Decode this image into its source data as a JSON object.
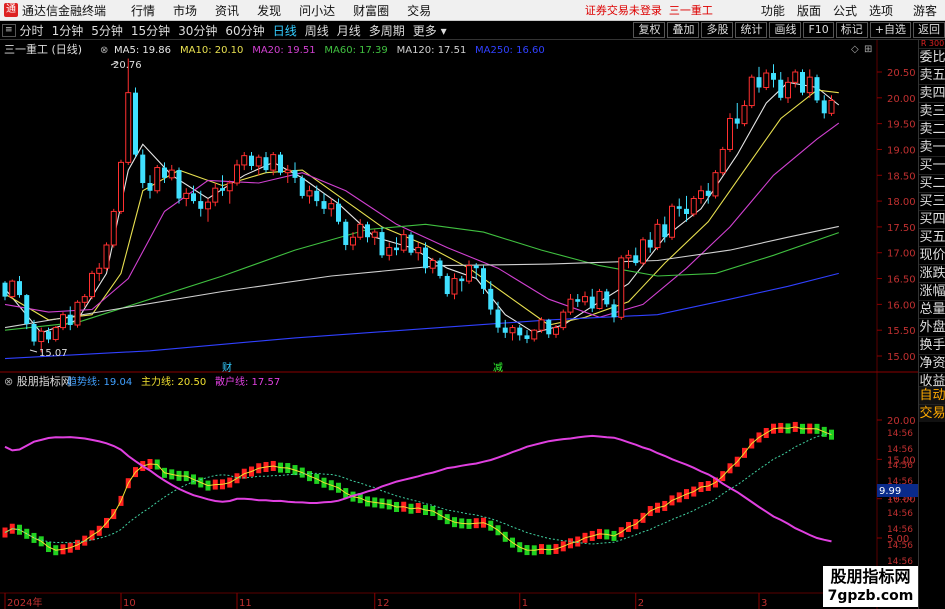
{
  "app": {
    "logo": "通",
    "title": "通达信金融终端",
    "menus": [
      "行情",
      "市场",
      "资讯",
      "发现",
      "问小达",
      "财富圈",
      "交易"
    ],
    "notice": "证券交易未登录",
    "stock_name": "三一重工",
    "right_menus": [
      "功能",
      "版面",
      "公式",
      "选项"
    ],
    "guest": "游客"
  },
  "toolbar": {
    "pt": "≡",
    "periods": [
      "分时",
      "1分钟",
      "5分钟",
      "15分钟",
      "30分钟",
      "60分钟",
      "日线",
      "周线",
      "月线",
      "多周期",
      "更多"
    ],
    "active_period": "日线",
    "right_buttons": [
      "复权",
      "叠加",
      "多股",
      "统计",
      "画线",
      "F10",
      "标记",
      "+自选",
      "返回"
    ]
  },
  "side": {
    "tag": "R 300",
    "items": [
      "委比",
      "卖五",
      "卖四",
      "卖三",
      "卖二",
      "卖一",
      "买一",
      "买二",
      "买三",
      "买四",
      "买五",
      "现价",
      "涨跌",
      "涨幅",
      "总量",
      "外盘",
      "换手",
      "净资",
      "收益",
      "自动",
      "交易"
    ]
  },
  "main": {
    "title": "三一重工 (日线)",
    "legend": [
      {
        "text": "MA5: 19.86",
        "color": "#e6e6e6"
      },
      {
        "text": "MA10: 20.10",
        "color": "#e8e050"
      },
      {
        "text": "MA20: 19.51",
        "color": "#d040d0"
      },
      {
        "text": "MA60: 17.39",
        "color": "#40c040"
      },
      {
        "text": "MA120: 17.51",
        "color": "#d0d0d0"
      },
      {
        "text": "MA250: 16.60",
        "color": "#3040ff"
      }
    ],
    "y_ticks": [
      "20.50",
      "20.00",
      "19.50",
      "19.00",
      "18.50",
      "18.00",
      "17.50",
      "17.00",
      "16.50",
      "16.00",
      "15.50",
      "15.00"
    ],
    "high_label": "20.76",
    "low_label": "15.07",
    "marks": [
      "财",
      "减"
    ],
    "candles": [
      [
        16.42,
        16.45,
        16.08,
        16.15
      ],
      [
        16.15,
        16.48,
        16.12,
        16.45
      ],
      [
        16.45,
        16.55,
        16.13,
        16.18
      ],
      [
        16.18,
        16.2,
        15.52,
        15.62
      ],
      [
        15.62,
        15.7,
        15.2,
        15.28
      ],
      [
        15.28,
        15.55,
        15.07,
        15.48
      ],
      [
        15.48,
        15.55,
        15.25,
        15.32
      ],
      [
        15.32,
        15.58,
        15.28,
        15.55
      ],
      [
        15.55,
        15.85,
        15.5,
        15.8
      ],
      [
        15.8,
        15.96,
        15.5,
        15.6
      ],
      [
        15.6,
        16.08,
        15.55,
        16.04
      ],
      [
        16.04,
        16.2,
        15.95,
        16.15
      ],
      [
        16.15,
        16.65,
        16.1,
        16.6
      ],
      [
        16.6,
        16.8,
        16.45,
        16.7
      ],
      [
        16.7,
        17.2,
        16.65,
        17.15
      ],
      [
        17.15,
        17.85,
        17.1,
        17.8
      ],
      [
        17.8,
        18.8,
        17.75,
        18.75
      ],
      [
        18.75,
        20.76,
        18.7,
        20.1
      ],
      [
        20.1,
        20.2,
        18.85,
        18.9
      ],
      [
        18.9,
        19.0,
        18.25,
        18.35
      ],
      [
        18.35,
        18.5,
        18.05,
        18.2
      ],
      [
        18.2,
        18.7,
        18.15,
        18.65
      ],
      [
        18.65,
        18.75,
        18.35,
        18.45
      ],
      [
        18.45,
        18.7,
        18.4,
        18.6
      ],
      [
        18.6,
        18.65,
        17.95,
        18.05
      ],
      [
        18.05,
        18.25,
        17.9,
        18.15
      ],
      [
        18.15,
        18.3,
        17.95,
        18.0
      ],
      [
        18.0,
        18.2,
        17.7,
        17.85
      ],
      [
        17.85,
        18.05,
        17.6,
        17.98
      ],
      [
        17.98,
        18.35,
        17.9,
        18.25
      ],
      [
        18.25,
        18.5,
        18.1,
        18.2
      ],
      [
        18.2,
        18.4,
        17.95,
        18.35
      ],
      [
        18.35,
        18.8,
        18.3,
        18.7
      ],
      [
        18.7,
        18.95,
        18.6,
        18.88
      ],
      [
        18.88,
        18.95,
        18.6,
        18.68
      ],
      [
        18.68,
        18.9,
        18.5,
        18.85
      ],
      [
        18.85,
        18.95,
        18.55,
        18.6
      ],
      [
        18.6,
        18.95,
        18.5,
        18.9
      ],
      [
        18.9,
        18.95,
        18.5,
        18.55
      ],
      [
        18.55,
        18.7,
        18.35,
        18.6
      ],
      [
        18.6,
        18.75,
        18.35,
        18.45
      ],
      [
        18.45,
        18.5,
        18.05,
        18.1
      ],
      [
        18.1,
        18.3,
        17.95,
        18.2
      ],
      [
        18.2,
        18.3,
        17.9,
        18.0
      ],
      [
        18.0,
        18.15,
        17.75,
        17.85
      ],
      [
        17.85,
        18.05,
        17.7,
        17.95
      ],
      [
        17.95,
        18.05,
        17.55,
        17.6
      ],
      [
        17.6,
        17.65,
        17.05,
        17.15
      ],
      [
        17.15,
        17.4,
        17.05,
        17.3
      ],
      [
        17.3,
        17.65,
        17.25,
        17.55
      ],
      [
        17.55,
        17.6,
        17.2,
        17.3
      ],
      [
        17.3,
        17.45,
        17.15,
        17.4
      ],
      [
        17.4,
        17.5,
        16.9,
        16.95
      ],
      [
        16.95,
        17.2,
        16.85,
        17.1
      ],
      [
        17.1,
        17.3,
        16.95,
        17.05
      ],
      [
        17.05,
        17.45,
        17.0,
        17.35
      ],
      [
        17.35,
        17.4,
        16.95,
        17.0
      ],
      [
        17.0,
        17.2,
        16.85,
        17.1
      ],
      [
        17.1,
        17.2,
        16.6,
        16.7
      ],
      [
        16.7,
        16.9,
        16.6,
        16.85
      ],
      [
        16.85,
        16.9,
        16.5,
        16.55
      ],
      [
        16.55,
        16.6,
        16.15,
        16.2
      ],
      [
        16.2,
        16.6,
        16.1,
        16.5
      ],
      [
        16.5,
        16.55,
        16.25,
        16.45
      ],
      [
        16.45,
        16.85,
        16.4,
        16.75
      ],
      [
        16.75,
        16.8,
        16.5,
        16.7
      ],
      [
        16.7,
        16.75,
        16.2,
        16.3
      ],
      [
        16.3,
        16.45,
        15.8,
        15.9
      ],
      [
        15.9,
        16.05,
        15.45,
        15.55
      ],
      [
        15.55,
        15.7,
        15.35,
        15.45
      ],
      [
        15.45,
        15.6,
        15.3,
        15.55
      ],
      [
        15.55,
        15.6,
        15.3,
        15.4
      ],
      [
        15.4,
        15.5,
        15.25,
        15.33
      ],
      [
        15.33,
        15.52,
        15.28,
        15.5
      ],
      [
        15.5,
        15.75,
        15.45,
        15.7
      ],
      [
        15.7,
        15.72,
        15.35,
        15.42
      ],
      [
        15.42,
        15.6,
        15.35,
        15.55
      ],
      [
        15.55,
        15.9,
        15.5,
        15.85
      ],
      [
        15.85,
        16.2,
        15.8,
        16.1
      ],
      [
        16.1,
        16.2,
        15.95,
        16.05
      ],
      [
        16.05,
        16.25,
        15.98,
        16.15
      ],
      [
        16.15,
        16.3,
        15.85,
        15.92
      ],
      [
        15.92,
        16.3,
        15.9,
        16.25
      ],
      [
        16.25,
        16.3,
        15.95,
        16.0
      ],
      [
        16.0,
        16.1,
        15.65,
        15.75
      ],
      [
        15.75,
        16.95,
        15.7,
        16.9
      ],
      [
        16.9,
        17.05,
        16.7,
        16.95
      ],
      [
        16.95,
        17.1,
        16.75,
        16.8
      ],
      [
        16.8,
        17.3,
        16.75,
        17.25
      ],
      [
        17.25,
        17.4,
        17.0,
        17.1
      ],
      [
        17.1,
        17.65,
        17.05,
        17.55
      ],
      [
        17.55,
        17.7,
        17.2,
        17.3
      ],
      [
        17.3,
        17.95,
        17.25,
        17.9
      ],
      [
        17.9,
        18.05,
        17.7,
        17.85
      ],
      [
        17.85,
        18.1,
        17.6,
        17.75
      ],
      [
        17.75,
        18.1,
        17.7,
        18.05
      ],
      [
        18.05,
        18.3,
        17.95,
        18.2
      ],
      [
        18.2,
        18.35,
        17.95,
        18.1
      ],
      [
        18.1,
        18.6,
        18.05,
        18.55
      ],
      [
        18.55,
        19.05,
        18.5,
        19.0
      ],
      [
        19.0,
        19.7,
        18.95,
        19.6
      ],
      [
        19.6,
        19.9,
        19.4,
        19.5
      ],
      [
        19.5,
        19.95,
        19.45,
        19.85
      ],
      [
        19.85,
        20.45,
        19.8,
        20.4
      ],
      [
        20.4,
        20.6,
        20.1,
        20.2
      ],
      [
        20.2,
        20.55,
        20.15,
        20.48
      ],
      [
        20.48,
        20.65,
        20.2,
        20.35
      ],
      [
        20.35,
        20.5,
        19.95,
        20.0
      ],
      [
        20.0,
        20.4,
        19.9,
        20.3
      ],
      [
        20.3,
        20.55,
        20.2,
        20.5
      ],
      [
        20.5,
        20.55,
        20.05,
        20.1
      ],
      [
        20.1,
        20.55,
        20.0,
        20.4
      ],
      [
        20.4,
        20.45,
        19.9,
        19.95
      ],
      [
        19.95,
        20.05,
        19.6,
        19.7
      ],
      [
        19.7,
        20.05,
        19.65,
        19.95
      ]
    ],
    "ma_lines": [
      {
        "color": "#e6e6e6",
        "pts": [
          [
            0,
            16.3
          ],
          [
            5,
            15.45
          ],
          [
            10,
            15.7
          ],
          [
            14,
            16.6
          ],
          [
            17,
            18.6
          ],
          [
            19,
            19.1
          ],
          [
            23,
            18.5
          ],
          [
            28,
            18.05
          ],
          [
            33,
            18.5
          ],
          [
            37,
            18.75
          ],
          [
            41,
            18.45
          ],
          [
            46,
            17.95
          ],
          [
            51,
            17.3
          ],
          [
            56,
            17.1
          ],
          [
            61,
            16.7
          ],
          [
            65,
            16.5
          ],
          [
            69,
            15.8
          ],
          [
            73,
            15.45
          ],
          [
            77,
            15.6
          ],
          [
            82,
            16.05
          ],
          [
            86,
            16.4
          ],
          [
            91,
            17.3
          ],
          [
            96,
            17.85
          ],
          [
            101,
            18.9
          ],
          [
            105,
            19.9
          ],
          [
            108,
            20.3
          ],
          [
            112,
            20.2
          ],
          [
            115,
            19.86
          ]
        ]
      },
      {
        "color": "#e8e050",
        "pts": [
          [
            0,
            16.2
          ],
          [
            6,
            15.7
          ],
          [
            12,
            15.8
          ],
          [
            16,
            16.6
          ],
          [
            19,
            18.2
          ],
          [
            24,
            18.6
          ],
          [
            30,
            18.3
          ],
          [
            36,
            18.55
          ],
          [
            41,
            18.6
          ],
          [
            47,
            18.0
          ],
          [
            52,
            17.5
          ],
          [
            58,
            17.15
          ],
          [
            64,
            16.7
          ],
          [
            70,
            16.1
          ],
          [
            75,
            15.6
          ],
          [
            80,
            15.75
          ],
          [
            86,
            16.05
          ],
          [
            91,
            16.8
          ],
          [
            97,
            17.6
          ],
          [
            102,
            18.6
          ],
          [
            107,
            19.6
          ],
          [
            112,
            20.15
          ],
          [
            115,
            20.1
          ]
        ]
      },
      {
        "color": "#d040d0",
        "pts": [
          [
            0,
            16.0
          ],
          [
            6,
            15.85
          ],
          [
            12,
            15.9
          ],
          [
            17,
            16.5
          ],
          [
            22,
            17.8
          ],
          [
            28,
            18.4
          ],
          [
            35,
            18.35
          ],
          [
            41,
            18.55
          ],
          [
            47,
            18.2
          ],
          [
            54,
            17.55
          ],
          [
            61,
            17.1
          ],
          [
            68,
            16.7
          ],
          [
            75,
            16.1
          ],
          [
            82,
            15.75
          ],
          [
            88,
            16.0
          ],
          [
            94,
            16.7
          ],
          [
            100,
            17.5
          ],
          [
            106,
            18.5
          ],
          [
            112,
            19.2
          ],
          [
            115,
            19.51
          ]
        ]
      },
      {
        "color": "#40c040",
        "pts": [
          [
            0,
            15.5
          ],
          [
            10,
            15.65
          ],
          [
            20,
            16.1
          ],
          [
            30,
            16.55
          ],
          [
            40,
            17.05
          ],
          [
            50,
            17.45
          ],
          [
            58,
            17.55
          ],
          [
            66,
            17.4
          ],
          [
            74,
            17.05
          ],
          [
            82,
            16.75
          ],
          [
            90,
            16.55
          ],
          [
            98,
            16.6
          ],
          [
            106,
            16.95
          ],
          [
            115,
            17.39
          ]
        ]
      },
      {
        "color": "#d0d0d0",
        "pts": [
          [
            0,
            15.55
          ],
          [
            15,
            15.9
          ],
          [
            30,
            16.25
          ],
          [
            45,
            16.55
          ],
          [
            60,
            16.75
          ],
          [
            75,
            16.78
          ],
          [
            90,
            16.85
          ],
          [
            100,
            17.05
          ],
          [
            108,
            17.3
          ],
          [
            115,
            17.51
          ]
        ]
      },
      {
        "color": "#3040ff",
        "pts": [
          [
            0,
            14.95
          ],
          [
            20,
            15.1
          ],
          [
            40,
            15.35
          ],
          [
            60,
            15.55
          ],
          [
            75,
            15.7
          ],
          [
            90,
            15.8
          ],
          [
            100,
            16.1
          ],
          [
            108,
            16.35
          ],
          [
            115,
            16.6
          ]
        ]
      }
    ]
  },
  "sub": {
    "title": "股朋指标网",
    "legend": [
      {
        "text": "趋势线: 19.04",
        "color": "#40a0ff"
      },
      {
        "text": "主力线: 20.50",
        "color": "#f0e030"
      },
      {
        "text": "散户线: 17.57",
        "color": "#e040e0"
      }
    ],
    "y_ticks": [
      "20.00",
      "15.00",
      "10.00",
      "5.00"
    ],
    "cur_label": "9.99",
    "time_labels": [
      "2024年",
      "10",
      "11",
      "12",
      "1",
      "2",
      "3"
    ]
  },
  "watermark": {
    "line1": "股朋指标网",
    "line2": "7gpzb.com"
  }
}
